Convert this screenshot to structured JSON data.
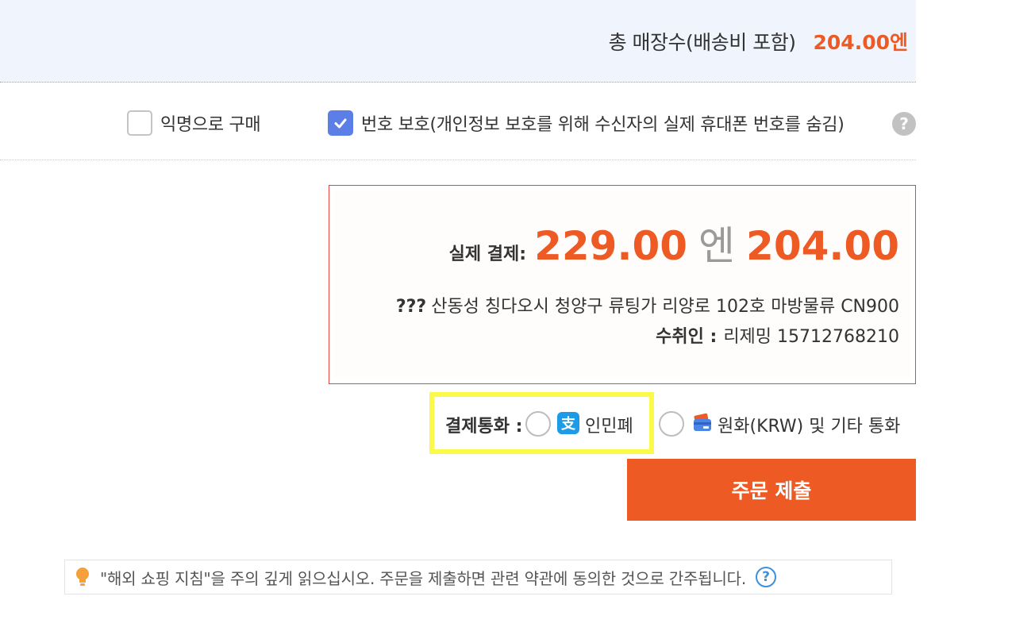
{
  "summary": {
    "total_label": "총 매장수(배송비 포함)",
    "total_value": "204.00엔"
  },
  "options": {
    "anonymous_label": "익명으로 구매",
    "anonymous_checked": false,
    "number_protect_label": "번호 보호(개인정보 보호를 위해 수신자의 실제 휴대폰 번호를 숨김)",
    "number_protect_checked": true,
    "help_glyph": "?"
  },
  "payment": {
    "label": "실제 결제:",
    "original_amount": "229.00",
    "unit": "엔",
    "final_amount": "204.00",
    "address_prefix": "???",
    "address": "산동성 칭다오시 청양구 류팅가 리양로 102호 마방물류 CN900",
    "receiver_label": "수취인 :",
    "receiver_value": "리제밍 15712768210"
  },
  "currency": {
    "label": "결제통화 :",
    "options": [
      {
        "label": "인민폐",
        "icon": "alipay-icon",
        "selected": false
      },
      {
        "label": "원화(KRW) 및 기타 통화",
        "icon": "card-icon",
        "selected": false
      }
    ],
    "alipay_glyph": "支"
  },
  "submit": {
    "label": "주문 제출"
  },
  "notice": {
    "text": "\"해외 쇼핑 지침\"을 주의 깊게 읽으십시오. 주문을 제출하면 관련 약관에 동의한 것으로 간주됩니다.",
    "help_glyph": "?"
  },
  "colors": {
    "accent": "#ee5a24",
    "checkbox_checked": "#5b7fe6",
    "highlight": "#fbf94a",
    "box_border": "#e64545"
  }
}
